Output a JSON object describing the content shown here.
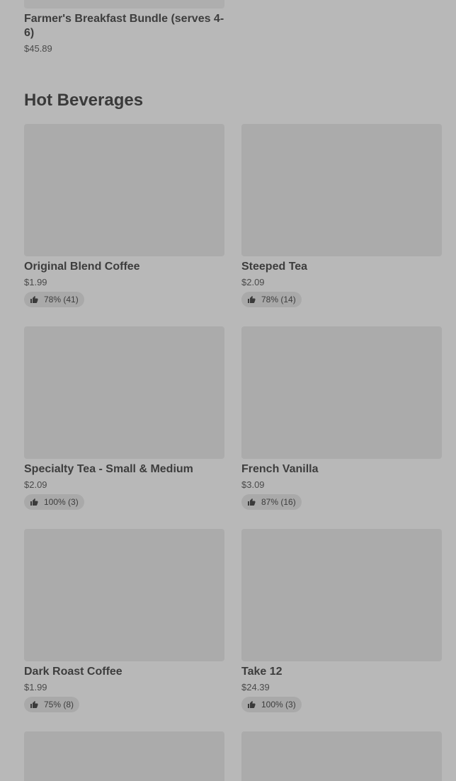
{
  "top_item": {
    "name": "Farmer's Breakfast Bundle (serves 4-6)",
    "price": "$45.89"
  },
  "section": {
    "title": "Hot Beverages"
  },
  "items": [
    {
      "name": "Original Blend Coffee",
      "price": "$1.99",
      "rating": "78% (41)"
    },
    {
      "name": "Steeped Tea",
      "price": "$2.09",
      "rating": "78% (14)"
    },
    {
      "name": "Specialty Tea - Small & Medium",
      "price": "$2.09",
      "rating": "100% (3)"
    },
    {
      "name": "French Vanilla",
      "price": "$3.09",
      "rating": "87% (16)"
    },
    {
      "name": "Dark Roast Coffee",
      "price": "$1.99",
      "rating": "75% (8)"
    },
    {
      "name": "Take 12",
      "price": "$24.39",
      "rating": "100% (3)"
    }
  ],
  "icons": {
    "rating": "thumbs-up-icon"
  },
  "colors": {
    "background": "#b8b8b8",
    "image_placeholder": "#ababab",
    "rating_pill": "#a9a9a9",
    "text": "#3d3d3d"
  }
}
